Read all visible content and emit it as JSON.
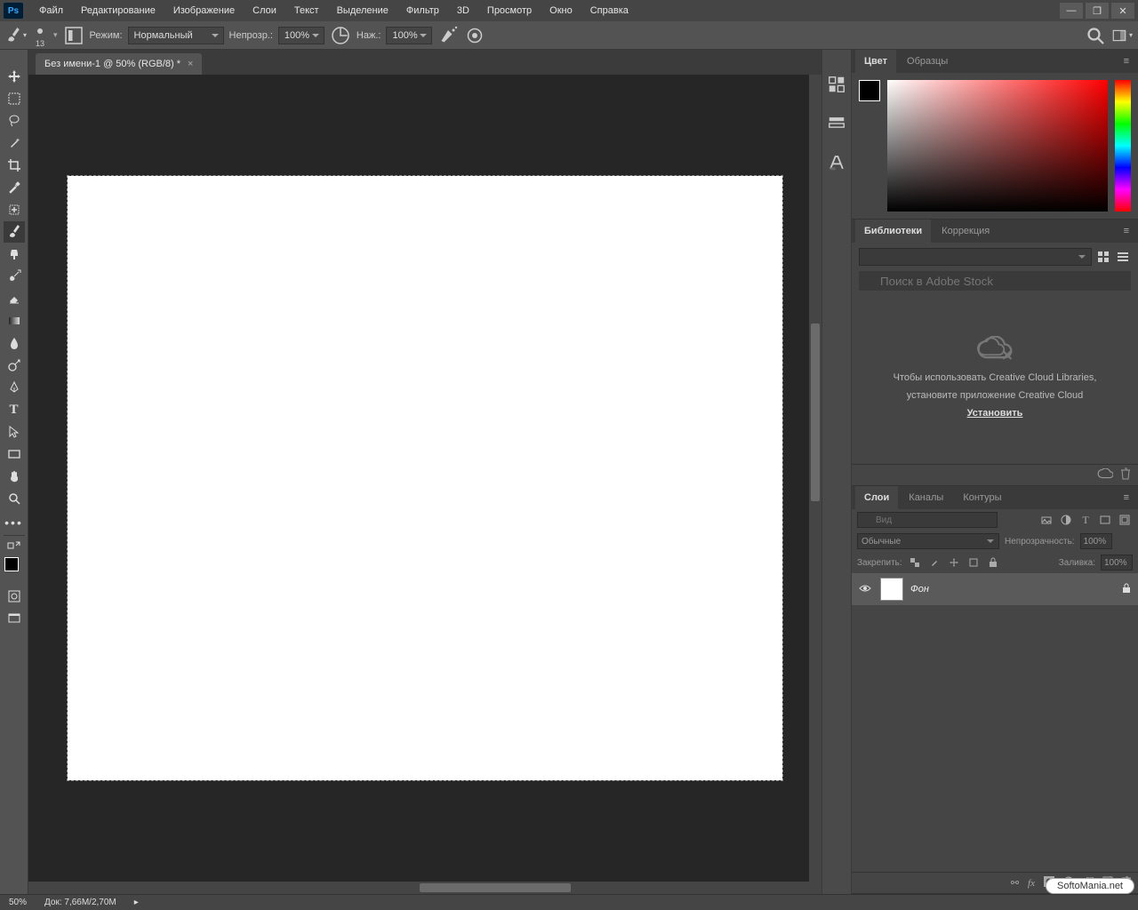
{
  "menu": [
    "Файл",
    "Редактирование",
    "Изображение",
    "Слои",
    "Текст",
    "Выделение",
    "Фильтр",
    "3D",
    "Просмотр",
    "Окно",
    "Справка"
  ],
  "options": {
    "brush_size": "13",
    "mode_label": "Режим:",
    "mode_value": "Нормальный",
    "opacity_label": "Непрозр.:",
    "opacity_value": "100%",
    "flow_label": "Наж.:",
    "flow_value": "100%"
  },
  "doc": {
    "tab_title": "Без имени-1 @ 50% (RGB/8) *"
  },
  "panels": {
    "color": {
      "tabs": [
        "Цвет",
        "Образцы"
      ],
      "active": 0
    },
    "libraries": {
      "tabs": [
        "Библиотеки",
        "Коррекция"
      ],
      "active": 0,
      "search_placeholder": "Поиск в Adobe Stock",
      "msg1": "Чтобы использовать Creative Cloud Libraries,",
      "msg2": "установите приложение Creative Cloud",
      "link": "Установить"
    },
    "layers": {
      "tabs": [
        "Слои",
        "Каналы",
        "Контуры"
      ],
      "active": 0,
      "filter_placeholder": "Вид",
      "blend_mode": "Обычные",
      "opacity_label": "Непрозрачность:",
      "opacity_value": "100%",
      "lock_label": "Закрепить:",
      "fill_label": "Заливка:",
      "fill_value": "100%",
      "layer_name": "Фон"
    }
  },
  "status": {
    "zoom": "50%",
    "doc_info": "Док: 7,66M/2,70M"
  },
  "watermark": "SoftoMania.net"
}
